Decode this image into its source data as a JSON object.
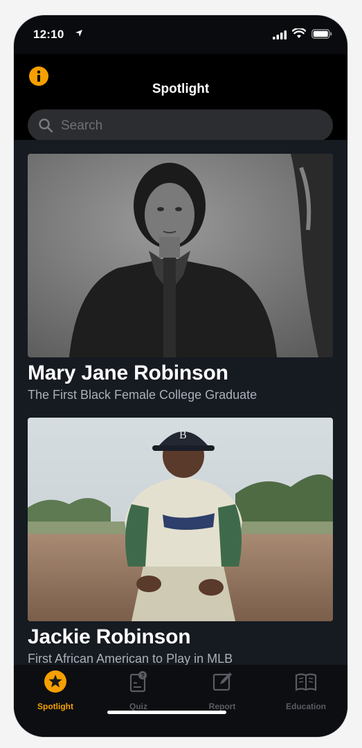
{
  "status_bar": {
    "time": "12:10"
  },
  "nav": {
    "title": "Spotlight"
  },
  "search": {
    "placeholder": "Search"
  },
  "cards": [
    {
      "name": "Mary Jane Robinson",
      "subtitle": "The First Black Female College Graduate",
      "image": "portrait-photo-bw"
    },
    {
      "name": "Jackie Robinson",
      "subtitle": "First African American to Play in MLB",
      "image": "baseball-player-photo"
    }
  ],
  "tabs": [
    {
      "label": "Spotlight",
      "icon": "star-icon",
      "active": true
    },
    {
      "label": "Quiz",
      "icon": "quiz-icon",
      "active": false
    },
    {
      "label": "Report",
      "icon": "edit-icon",
      "active": false
    },
    {
      "label": "Education",
      "icon": "book-icon",
      "active": false
    }
  ],
  "colors": {
    "accent": "#f5a000",
    "inactive_tab": "#5a5c63",
    "background": "#161a21"
  }
}
